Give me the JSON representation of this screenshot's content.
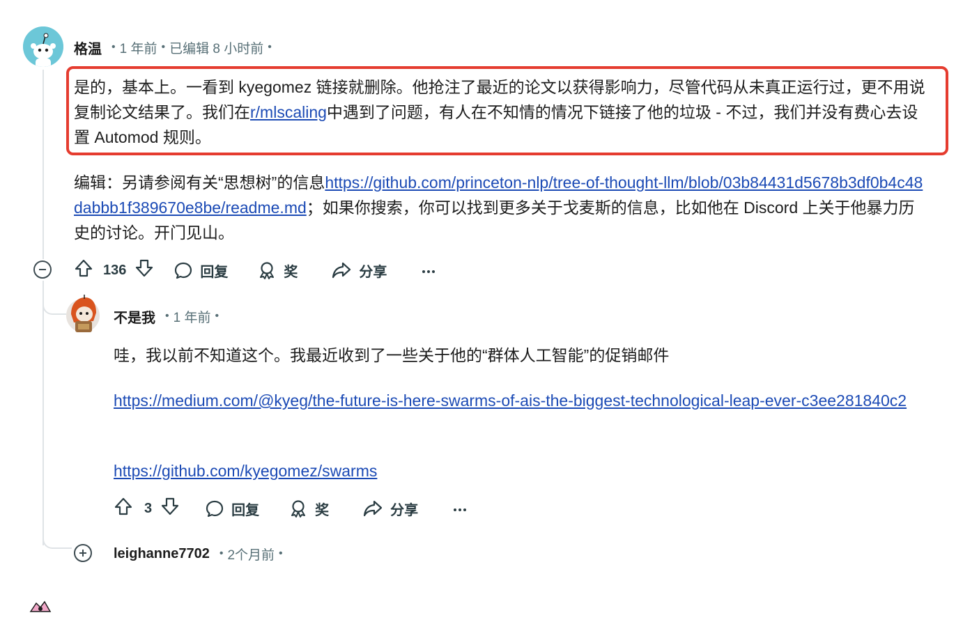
{
  "comment1": {
    "username": "格温",
    "time": "1 年前",
    "edited": "已编辑 8 小时前",
    "para1_a": "是的，基本上。一看到 kyegomez 链接就删除。他抢注了最近的论文以获得影响力，尽管代码从未真正运行过，更不用说复制论文结果了。我们在",
    "subreddit_link": "r/mlscaling",
    "para1_b": "中遇到了问题，有人在不知情的情况下链接了他的垃圾 - 不过，我们并没有费心去设置 Automod 规则。",
    "para2_a": "编辑：另请参阅有关“思想树”的信息",
    "para2_link": "https://github.com/princeton-nlp/tree-of-thought-llm/blob/03b84431d5678b3df0b4c48dabbb1f389670e8be/readme.md",
    "para2_b": "；如果你搜索，你可以找到更多关于戈麦斯的信息，比如他在 Discord 上关于他暴力历史的讨论。开门见山。",
    "votes": "136",
    "reply_label": "回复",
    "award_label": "奖",
    "share_label": "分享"
  },
  "comment2": {
    "username": "不是我",
    "time": "1 年前",
    "text": "哇，我以前不知道这个。我最近收到了一些关于他的“群体人工智能”的促销邮件",
    "link1": "https://medium.com/@kyeg/the-future-is-here-swarms-of-ais-the-biggest-technological-leap-ever-c3ee281840c2",
    "link2": "https://github.com/kyegomez/swarms",
    "votes": "3",
    "reply_label": "回复",
    "award_label": "奖",
    "share_label": "分享"
  },
  "comment3": {
    "username": "leighanne7702",
    "time": "2个月前"
  },
  "colors": {
    "highlight_border": "#e53c2f",
    "link": "#1b4ab5",
    "meta": "#576f76",
    "thread_line": "#dfe3e6"
  }
}
